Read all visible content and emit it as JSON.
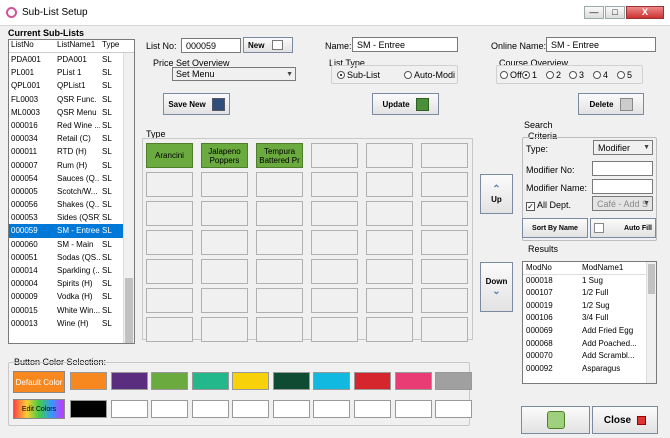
{
  "window": {
    "title": "Sub-List Setup",
    "minimize": "—",
    "restore": "□",
    "close": "X"
  },
  "sublists": {
    "heading": "Current Sub-Lists",
    "columns": [
      "ListNo",
      "ListName1",
      "Type"
    ],
    "rows": [
      [
        "PDA001",
        "PDA001",
        "SL"
      ],
      [
        "PL001",
        "PList 1",
        "SL"
      ],
      [
        "QPL001",
        "QPList1",
        "SL"
      ],
      [
        "FL0003",
        "QSR Func.",
        "SL"
      ],
      [
        "ML0003",
        "QSR Menu",
        "SL"
      ],
      [
        "000016",
        "Red Wine ...",
        "SL"
      ],
      [
        "000034",
        "Retail (C)",
        "SL"
      ],
      [
        "000011",
        "RTD (H)",
        "SL"
      ],
      [
        "000007",
        "Rum (H)",
        "SL"
      ],
      [
        "000054",
        "Sauces (Q...",
        "SL"
      ],
      [
        "000005",
        "Scotch/W...",
        "SL"
      ],
      [
        "000056",
        "Shakes (Q...",
        "SL"
      ],
      [
        "000053",
        "Sides (QSR)",
        "SL"
      ],
      [
        "000059",
        "SM - Entree",
        "SL"
      ],
      [
        "000060",
        "SM - Main",
        "SL"
      ],
      [
        "000051",
        "Sodas (QS...",
        "SL"
      ],
      [
        "000014",
        "Sparkling (...",
        "SL"
      ],
      [
        "000004",
        "Spirits (H)",
        "SL"
      ],
      [
        "000009",
        "Vodka (H)",
        "SL"
      ],
      [
        "000015",
        "White Win...",
        "SL"
      ],
      [
        "000013",
        "Wine (H)",
        "SL"
      ]
    ],
    "selected_index": 13
  },
  "form": {
    "list_no_label": "List No:",
    "list_no_value": "000059",
    "new_label": "New",
    "name_label": "Name:",
    "name_value": "SM - Entree",
    "online_name_label": "Online Name:",
    "online_name_value": "SM - Entree",
    "price_set_label": "Price Set Overview",
    "price_set_value": "Set Menu",
    "list_type_label": "List Type",
    "list_type_options": [
      "Sub-List",
      "Auto-Modi"
    ],
    "list_type_selected": "Sub-List",
    "course_label": "Course Overview",
    "course_options": [
      "Off",
      "1",
      "2",
      "3",
      "4",
      "5"
    ],
    "course_selected": "1",
    "save_new_label": "Save New",
    "update_label": "Update",
    "delete_label": "Delete"
  },
  "type_grid": {
    "label": "Type",
    "buttons": [
      "Arancini",
      "Jalapeno Poppers",
      "Tempura Battered Pr"
    ],
    "up_label": "Up",
    "down_label": "Down"
  },
  "search": {
    "heading": "Search",
    "criteria_label": "Criteria",
    "type_label": "Type:",
    "type_value": "Modifier",
    "modifier_no_label": "Modifier No:",
    "modifier_no_value": "",
    "modifier_name_label": "Modifier Name:",
    "modifier_name_value": "",
    "all_dept_label": "All Dept.",
    "all_dept_checked": true,
    "dept_value": "Café - Add S",
    "sort_by_name_label": "Sort By Name",
    "auto_fill_label": "Auto Fill"
  },
  "results": {
    "heading": "Results",
    "columns": [
      "ModNo",
      "ModName1"
    ],
    "rows": [
      [
        "000018",
        "1 Sug"
      ],
      [
        "000107",
        "1/2 Full"
      ],
      [
        "000019",
        "1/2 Sug"
      ],
      [
        "000106",
        "3/4 Full"
      ],
      [
        "000069",
        "Add Fried Egg"
      ],
      [
        "000068",
        "Add Poached..."
      ],
      [
        "000070",
        "Add Scrambl..."
      ],
      [
        "000092",
        "Asparagus"
      ]
    ]
  },
  "colors": {
    "label": "Button Color Selection:",
    "default_label": "Default Color",
    "edit_label": "Edit Colors",
    "row1": [
      "#f7871f",
      "#5b2d7e",
      "#6aaa3e",
      "#23b88c",
      "#f7d20a",
      "#0f4a33",
      "#11b9e1",
      "#d4262c",
      "#e93b74",
      "#a0a0a0"
    ],
    "row2": [
      "#000000",
      "#ffffff",
      "#ffffff",
      "#ffffff",
      "#ffffff",
      "#ffffff",
      "#ffffff",
      "#ffffff",
      "#ffffff",
      "#ffffff",
      "#ffffff"
    ],
    "default_swatch": "#f7871f"
  },
  "footer": {
    "close_label": "Close"
  }
}
